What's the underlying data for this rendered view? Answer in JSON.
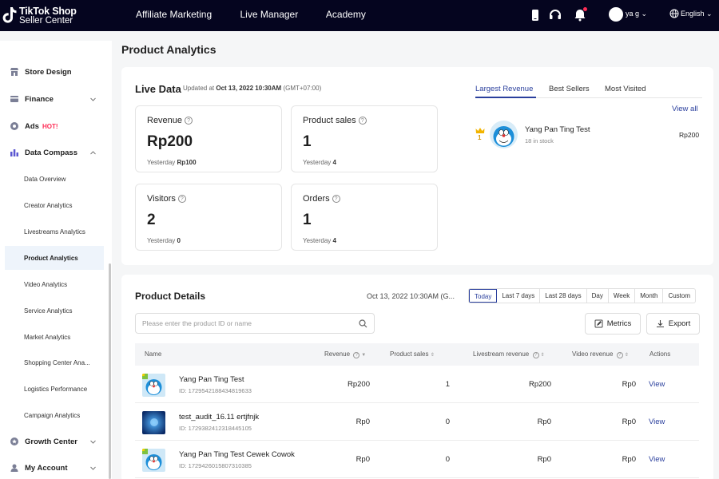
{
  "brand": {
    "line1": "TikTok Shop",
    "line2": "Seller Center"
  },
  "topnav": [
    "Affiliate Marketing",
    "Live Manager",
    "Academy"
  ],
  "user": {
    "name": "ya g"
  },
  "language": "English",
  "sidebar": {
    "store_design": "Store Design",
    "finance": "Finance",
    "ads": "Ads",
    "ads_badge": "HOT!",
    "data_compass": "Data Compass",
    "sub": [
      "Data Overview",
      "Creator Analytics",
      "Livestreams Analytics",
      "Product Analytics",
      "Video Analytics",
      "Service Analytics",
      "Market Analytics",
      "Shopping Center Ana...",
      "Logistics Performance",
      "Campaign Analytics"
    ],
    "growth_center": "Growth Center",
    "my_account": "My Account"
  },
  "page_title": "Product Analytics",
  "live_data": {
    "title": "Live Data",
    "updated_prefix": "Updated at",
    "updated_time": "Oct 13, 2022 10:30AM",
    "updated_tz": "(GMT+07:00)",
    "yesterday_label": "Yesterday",
    "metrics": [
      {
        "label": "Revenue",
        "value": "Rp200",
        "yesterday": "Rp100"
      },
      {
        "label": "Product sales",
        "value": "1",
        "yesterday": "4"
      },
      {
        "label": "Visitors",
        "value": "2",
        "yesterday": "0"
      },
      {
        "label": "Orders",
        "value": "1",
        "yesterday": "4"
      }
    ],
    "tabs": [
      "Largest Revenue",
      "Best Sellers",
      "Most Visited"
    ],
    "view_all": "View all",
    "top_product": {
      "rank": "1",
      "name": "Yang Pan Ting Test",
      "stock": "18 in stock",
      "revenue": "Rp200"
    }
  },
  "product_details": {
    "title": "Product Details",
    "date": "Oct 13, 2022 10:30AM (G...",
    "ranges": [
      "Today",
      "Last 7 days",
      "Last 28 days",
      "Day",
      "Week",
      "Month",
      "Custom"
    ],
    "search_placeholder": "Please enter the product ID or name",
    "metrics_btn": "Metrics",
    "export_btn": "Export",
    "columns": {
      "name": "Name",
      "revenue": "Revenue",
      "sales": "Product sales",
      "live_rev": "Livestream revenue",
      "video_rev": "Video revenue",
      "actions": "Actions"
    },
    "view_label": "View",
    "rows": [
      {
        "name": "Yang Pan Ting Test",
        "id": "ID: 1729542188434819633",
        "revenue": "Rp200",
        "sales": "1",
        "live_rev": "Rp200",
        "video_rev": "Rp0"
      },
      {
        "name": "test_audit_16.11 ertjfnjk",
        "id": "ID: 1729382412318445105",
        "revenue": "Rp0",
        "sales": "0",
        "live_rev": "Rp0",
        "video_rev": "Rp0"
      },
      {
        "name": "Yang Pan Ting Test Cewek Cowok",
        "id": "ID: 1729426015807310385",
        "revenue": "Rp0",
        "sales": "0",
        "live_rev": "Rp0",
        "video_rev": "Rp0"
      }
    ]
  },
  "colors": {
    "topbar": "#05051f",
    "accent": "#2a3f9d",
    "hot": "#fe2c55"
  }
}
